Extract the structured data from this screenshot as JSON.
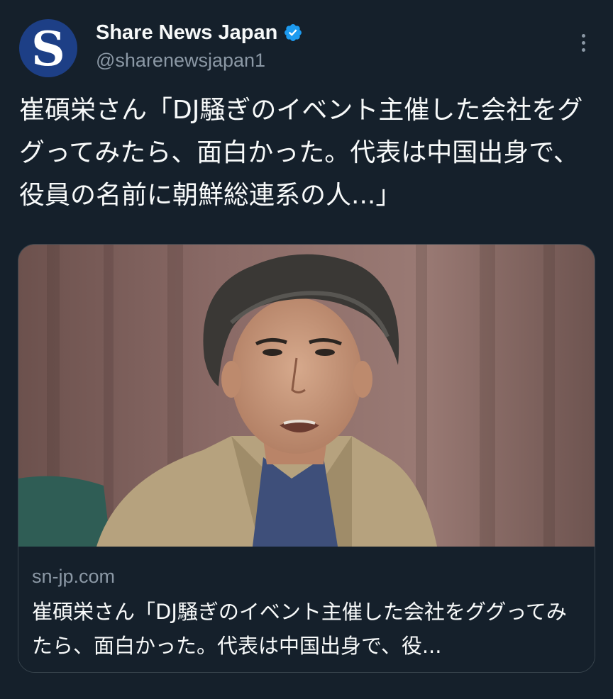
{
  "account": {
    "avatar_letter": "S",
    "display_name": "Share News Japan",
    "handle": "@sharenewsjapan1",
    "verified": true
  },
  "tweet": {
    "text": "崔碩栄さん「DJ騒ぎのイベント主催した会社をググってみたら、面白かった。代表は中国出身で、役員の名前に朝鮮総連系の人...」"
  },
  "link_card": {
    "domain": "sn-jp.com",
    "title": "崔碩栄さん「DJ騒ぎのイベント主催した会社をググってみたら、面白かった。代表は中国出身で、役..."
  },
  "icons": {
    "verified": "verified-badge-icon",
    "more": "more-options-icon"
  },
  "colors": {
    "background": "#15202b",
    "text_primary": "#f7f9f9",
    "text_secondary": "#8b98a5",
    "verified_blue": "#1d9bf0",
    "avatar_bg": "#1d3f86",
    "card_border": "#38444d"
  }
}
